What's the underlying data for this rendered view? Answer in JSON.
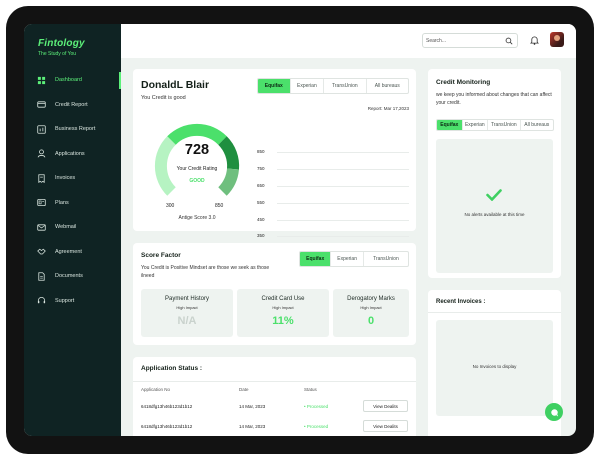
{
  "brand": {
    "name": "Fintology",
    "tagline": "The Study of You"
  },
  "sidebar": {
    "items": [
      {
        "label": "Dashboard",
        "icon": "grid-icon",
        "active": true
      },
      {
        "label": "Credit Report",
        "icon": "card-icon"
      },
      {
        "label": "Business Report",
        "icon": "chart-icon"
      },
      {
        "label": "Applications",
        "icon": "user-icon"
      },
      {
        "label": "Invoices",
        "icon": "invoice-icon"
      },
      {
        "label": "Plans",
        "icon": "plans-icon"
      },
      {
        "label": "Webmail",
        "icon": "mail-icon"
      },
      {
        "label": "Agreement",
        "icon": "handshake-icon"
      },
      {
        "label": "Documents",
        "icon": "document-icon"
      },
      {
        "label": "Support",
        "icon": "headset-icon"
      }
    ]
  },
  "topbar": {
    "search_placeholder": "Search..."
  },
  "credit": {
    "name": "DonaldL Blair",
    "status": "You Credit is good",
    "bureaus": [
      "Equifax",
      "Experian",
      "TransUnion",
      "All bureaus"
    ],
    "selected_bureau": "Equifax",
    "report_date": "Report: Mar 17,2023",
    "score": "728",
    "rating_label": "Your Credit Rating",
    "rating_value": "GOOD",
    "min": "300",
    "max": "850",
    "model": "Antige Score 3.0",
    "scale_ticks": [
      "850",
      "750",
      "650",
      "550",
      "450",
      "350"
    ]
  },
  "score_factor": {
    "title": "Score Factor",
    "description": "You Credit is Positive Mindset are those we seek as those ilneed",
    "bureaus": [
      "Equifax",
      "Experian",
      "TransUnion"
    ],
    "selected_bureau": "Equifax",
    "tiles": [
      {
        "title": "Payment History",
        "impact": "High Impact",
        "value": "N/A",
        "color": "#c9d2cd"
      },
      {
        "title": "Credit Card Use",
        "impact": "High Impact",
        "value": "11%",
        "color": "#4be06b"
      },
      {
        "title": "Derogatory Marks",
        "impact": "High Impact",
        "value": "0",
        "color": "#4be06b"
      }
    ]
  },
  "applications": {
    "title": "Application Status :",
    "columns": [
      "Application No",
      "Date",
      "Status"
    ],
    "rows": [
      {
        "no": "6418dfg13h46b123d1b12",
        "date": "14 Mar, 2023",
        "status": "• Processed",
        "action": "View Dealits"
      },
      {
        "no": "6418dfg13h46b123d1b12",
        "date": "14 Mar, 2023",
        "status": "• Processed",
        "action": "View Dealits"
      }
    ]
  },
  "monitoring": {
    "title": "Credit Monitoring",
    "description": "we keep you informed about changes that can affect your credit.",
    "bureaus": [
      "Equifax",
      "Experian",
      "TransUnion",
      "All bureaus"
    ],
    "selected_bureau": "Equifax",
    "empty_message": "No alerts available at this time"
  },
  "invoices": {
    "title": "Recent Invoices :",
    "empty_message": "No Invoices to display"
  },
  "colors": {
    "accent": "#4be06b",
    "sidebar_bg": "#0f2323",
    "gauge_light": "#b6f3c2",
    "gauge_mid": "#4be06b",
    "gauge_dark": "#1f8f3f",
    "gauge_muted": "#6fbf7e"
  }
}
